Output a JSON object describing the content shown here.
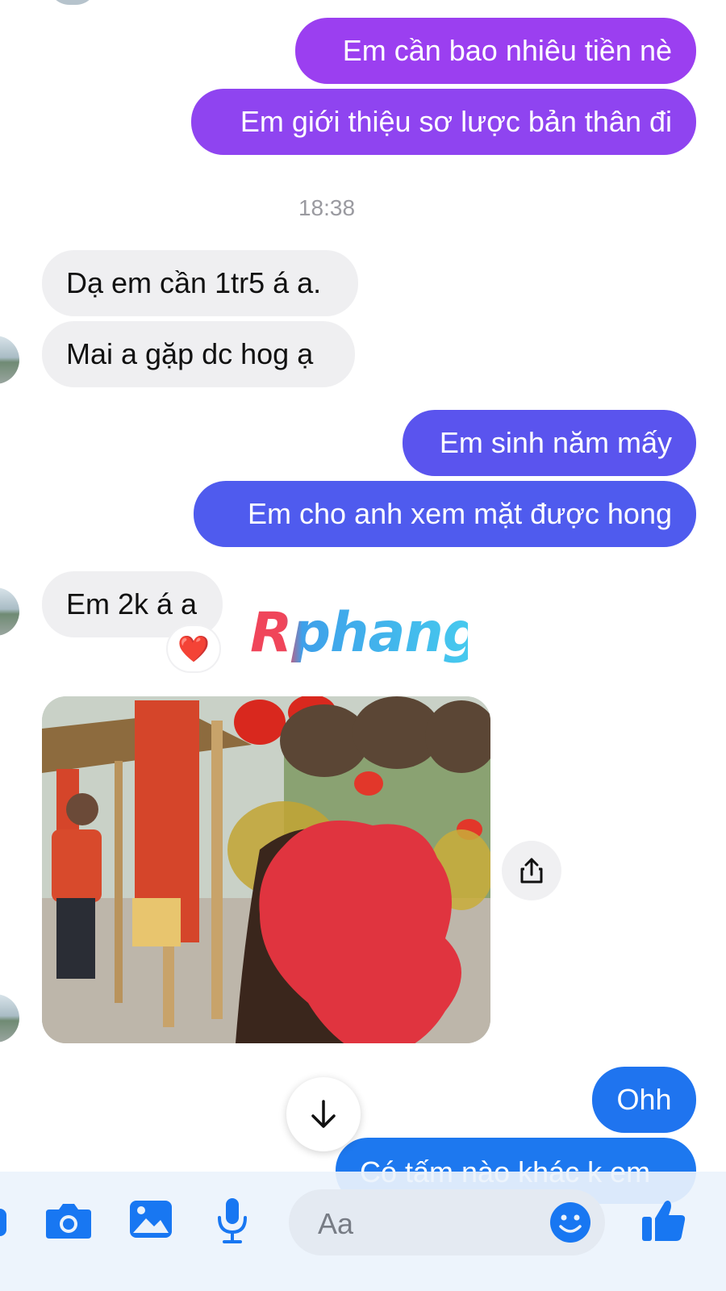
{
  "messages": {
    "m1": "Em cần bao nhiêu tiền nè",
    "m2": "Em giới thiệu sơ lược bản thân đi",
    "timestamp": "18:38",
    "m3": "Dạ em cần 1tr5 á a.",
    "m4": "Mai a gặp dc hog ạ",
    "m5": "Em sinh năm mấy",
    "m6": "Em cho anh xem mặt được hong",
    "m7": "Em 2k á a",
    "reaction": "❤️",
    "m8": "Ohh",
    "m9": "Có tấm nào khác k em"
  },
  "watermark": {
    "text": "Rphang"
  },
  "composer": {
    "placeholder": "Aa"
  },
  "colors": {
    "outgoing_top": "#9b3ff0",
    "outgoing_mid": "#5a54ee",
    "outgoing_bottom": "#1f74ef",
    "incoming": "#efeff1",
    "accent": "#1877f2"
  },
  "icons": [
    "camera-icon",
    "image-icon",
    "microphone-icon",
    "emoji-icon",
    "thumbs-up-icon",
    "share-icon",
    "arrow-down-icon"
  ]
}
